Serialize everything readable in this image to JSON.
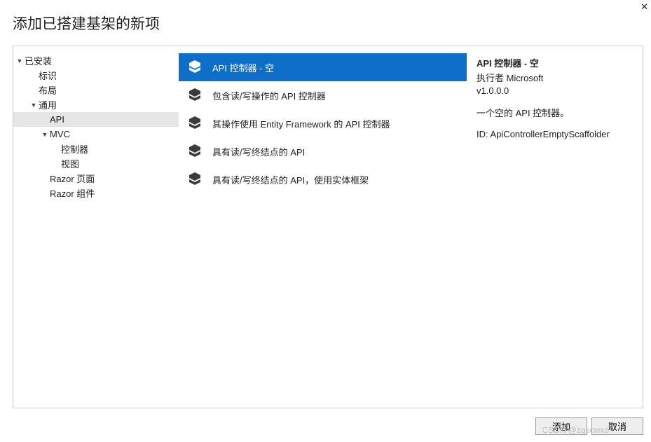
{
  "dialog": {
    "title": "添加已搭建基架的新项"
  },
  "tree": {
    "installed": {
      "label": "已安装",
      "caret": "▼"
    },
    "identity": {
      "label": "标识"
    },
    "layout": {
      "label": "布局"
    },
    "common": {
      "label": "通用",
      "caret": "▼"
    },
    "api": {
      "label": "API"
    },
    "mvc": {
      "label": "MVC",
      "caret": "▼"
    },
    "controller": {
      "label": "控制器"
    },
    "view": {
      "label": "视图"
    },
    "razorPage": {
      "label": "Razor 页面"
    },
    "razorComp": {
      "label": "Razor 组件"
    }
  },
  "list": {
    "items": [
      {
        "label": "API 控制器 - 空"
      },
      {
        "label": "包含读/写操作的 API 控制器"
      },
      {
        "label": "其操作使用 Entity Framework 的 API 控制器"
      },
      {
        "label": "具有读/写终结点的 API"
      },
      {
        "label": "具有读/写终结点的 API，使用实体框架"
      }
    ]
  },
  "detail": {
    "title": "API 控制器 - 空",
    "by": "执行者 Microsoft",
    "version": "v1.0.0.0",
    "desc": "一个空的 API 控制器。",
    "id_label": "ID: ",
    "id_value": "ApiControllerEmptyScaffolder"
  },
  "buttons": {
    "add": "添加",
    "cancel": "取消"
  },
  "watermark": "CSDN @zgscwxd"
}
